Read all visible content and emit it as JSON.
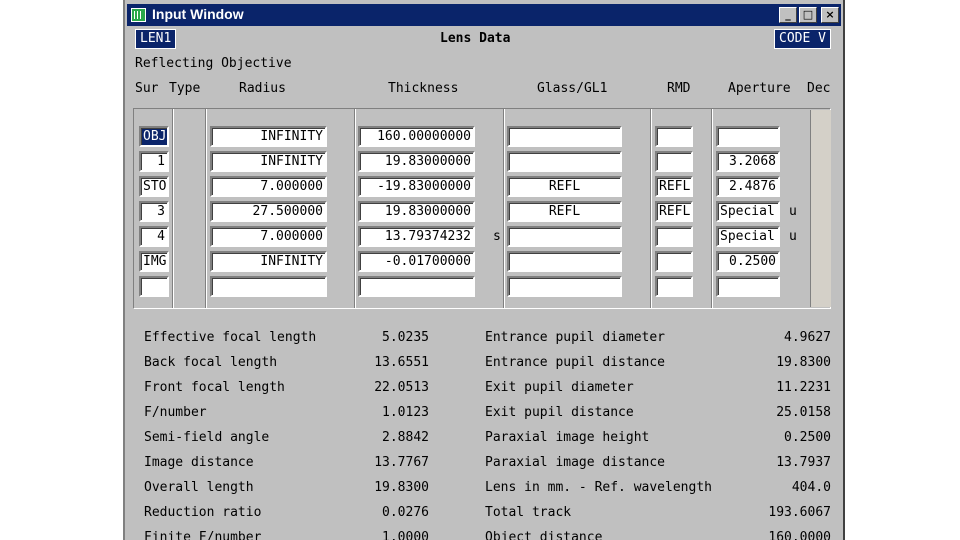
{
  "window": {
    "title": "Input Window",
    "buttons": {
      "minimize": "_",
      "maximize": "□",
      "close": "×"
    }
  },
  "header": {
    "lens_id": "LEN1",
    "section_title": "Lens Data",
    "code_button": "CODE V",
    "description": "Reflecting Objective"
  },
  "columns": {
    "sur": "Sur",
    "type": "Type",
    "radius": "Radius",
    "thickness": "Thickness",
    "glass": "Glass/GL1",
    "rmd": "RMD",
    "aperture": "Aperture",
    "dec": "Dec"
  },
  "rows": [
    {
      "sur": "OBJ",
      "radius": "INFINITY",
      "thickness": "160.00000000",
      "tflag": "",
      "glass": "",
      "rmd": "",
      "aperture": "",
      "aflag": ""
    },
    {
      "sur": "1",
      "radius": "INFINITY",
      "thickness": "19.83000000",
      "tflag": "",
      "glass": "",
      "rmd": "",
      "aperture": "3.2068",
      "aflag": ""
    },
    {
      "sur": "STO",
      "radius": "7.000000",
      "thickness": "-19.83000000",
      "tflag": "",
      "glass": "REFL",
      "rmd": "REFL",
      "aperture": "2.4876",
      "aflag": ""
    },
    {
      "sur": "3",
      "radius": "27.500000",
      "thickness": "19.83000000",
      "tflag": "",
      "glass": "REFL",
      "rmd": "REFL",
      "aperture": "Special",
      "aflag": "u"
    },
    {
      "sur": "4",
      "radius": "7.000000",
      "thickness": "13.79374232",
      "tflag": "s",
      "glass": "",
      "rmd": "",
      "aperture": "Special",
      "aflag": "u"
    },
    {
      "sur": "IMG",
      "radius": "INFINITY",
      "thickness": "-0.01700000",
      "tflag": "",
      "glass": "",
      "rmd": "",
      "aperture": "0.2500",
      "aflag": ""
    },
    {
      "sur": "",
      "radius": "",
      "thickness": "",
      "tflag": "",
      "glass": "",
      "rmd": "",
      "aperture": "",
      "aflag": ""
    }
  ],
  "stats_left": [
    {
      "label": "Effective focal length",
      "value": "5.0235"
    },
    {
      "label": "Back focal length",
      "value": "13.6551"
    },
    {
      "label": "Front focal length",
      "value": "22.0513"
    },
    {
      "label": "F/number",
      "value": "1.0123"
    },
    {
      "label": "Semi-field angle",
      "value": "2.8842"
    },
    {
      "label": "Image distance",
      "value": "13.7767"
    },
    {
      "label": "Overall length",
      "value": "19.8300"
    },
    {
      "label": "Reduction ratio",
      "value": "0.0276"
    },
    {
      "label": "Finite F/number",
      "value": "1.0000"
    }
  ],
  "stats_right": [
    {
      "label": "Entrance pupil diameter",
      "value": "4.9627"
    },
    {
      "label": "Entrance pupil distance",
      "value": "19.8300"
    },
    {
      "label": "Exit pupil diameter",
      "value": "11.2231"
    },
    {
      "label": "Exit pupil distance",
      "value": "25.0158"
    },
    {
      "label": "Paraxial image height",
      "value": "0.2500"
    },
    {
      "label": "Paraxial image distance",
      "value": "13.7937"
    },
    {
      "label": "Lens in mm. - Ref. wavelength",
      "value": "404.0"
    },
    {
      "label": "Total track",
      "value": "193.6067"
    },
    {
      "label": "Object distance",
      "value": "160.0000"
    }
  ],
  "colors": {
    "title_bar": "#0a246a",
    "window_bg": "#c0c0c0",
    "cell_bg": "#ffffff"
  }
}
